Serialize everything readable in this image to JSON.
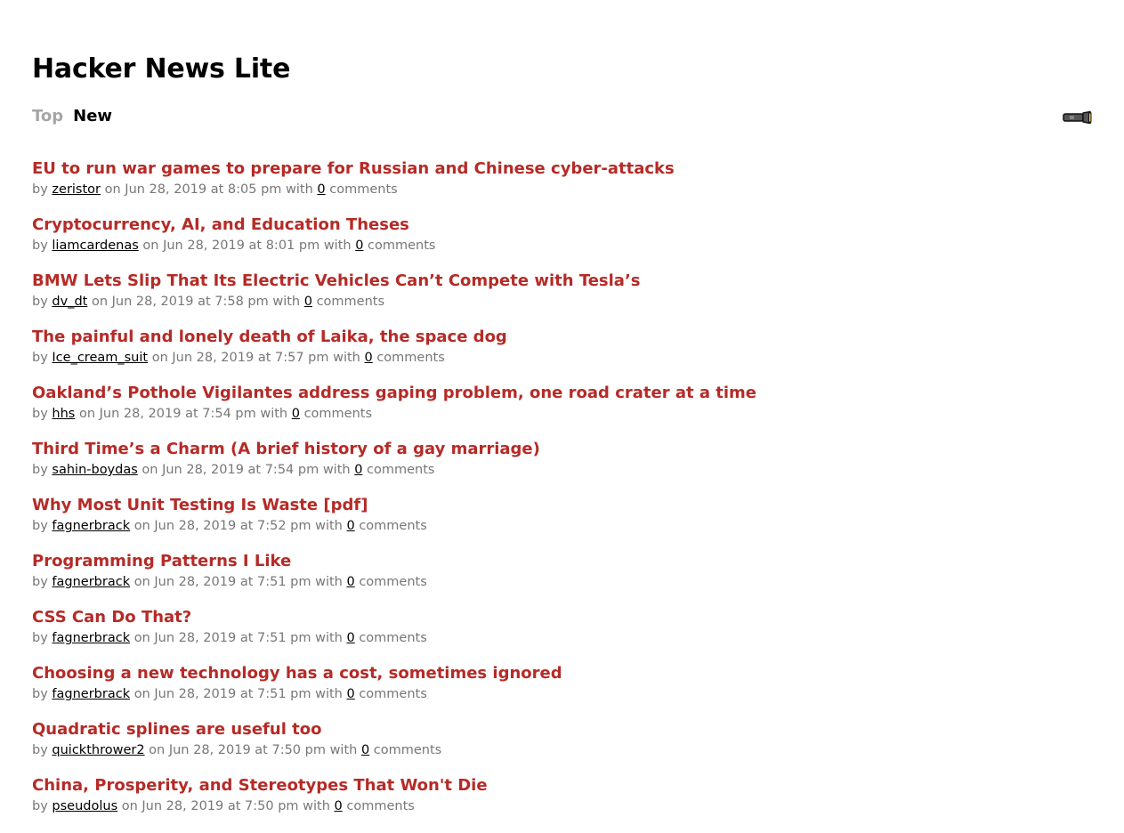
{
  "site": {
    "title": "Hacker News Lite"
  },
  "nav": {
    "tabs": [
      {
        "label": "Top",
        "active": false
      },
      {
        "label": "New",
        "active": true
      }
    ],
    "theme_toggle_icon": "flashlight-icon"
  },
  "meta_words": {
    "by": "by",
    "on": "on",
    "with": "with",
    "comments": "comments"
  },
  "stories": [
    {
      "title": "EU to run war games to prepare for Russian and Chinese cyber-attacks",
      "author": "zeristor",
      "date": "Jun 28, 2019 at 8:05 pm",
      "comments": "0"
    },
    {
      "title": "Cryptocurrency, AI, and Education Theses",
      "author": "liamcardenas",
      "date": "Jun 28, 2019 at 8:01 pm",
      "comments": "0"
    },
    {
      "title": "BMW Lets Slip That Its Electric Vehicles Can’t Compete with Tesla’s",
      "author": "dv_dt",
      "date": "Jun 28, 2019 at 7:58 pm",
      "comments": "0"
    },
    {
      "title": "The painful and lonely death of Laika, the space dog",
      "author": "Ice_cream_suit",
      "date": "Jun 28, 2019 at 7:57 pm",
      "comments": "0"
    },
    {
      "title": "Oakland’s Pothole Vigilantes address gaping problem, one road crater at a time",
      "author": "hhs",
      "date": "Jun 28, 2019 at 7:54 pm",
      "comments": "0"
    },
    {
      "title": "Third Time’s a Charm (A brief history of a gay marriage)",
      "author": "sahin-boydas",
      "date": "Jun 28, 2019 at 7:54 pm",
      "comments": "0"
    },
    {
      "title": "Why Most Unit Testing Is Waste [pdf]",
      "author": "fagnerbrack",
      "date": "Jun 28, 2019 at 7:52 pm",
      "comments": "0"
    },
    {
      "title": "Programming Patterns I Like",
      "author": "fagnerbrack",
      "date": "Jun 28, 2019 at 7:51 pm",
      "comments": "0"
    },
    {
      "title": "CSS Can Do That?",
      "author": "fagnerbrack",
      "date": "Jun 28, 2019 at 7:51 pm",
      "comments": "0"
    },
    {
      "title": "Choosing a new technology has a cost, sometimes ignored",
      "author": "fagnerbrack",
      "date": "Jun 28, 2019 at 7:51 pm",
      "comments": "0"
    },
    {
      "title": "Quadratic splines are useful too",
      "author": "quickthrower2",
      "date": "Jun 28, 2019 at 7:50 pm",
      "comments": "0"
    },
    {
      "title": "China, Prosperity, and Stereotypes That Won't Die",
      "author": "pseudolus",
      "date": "Jun 28, 2019 at 7:50 pm",
      "comments": "0"
    }
  ],
  "colors": {
    "story_title": "#b52b27",
    "meta_text": "#777777",
    "inactive_tab": "#a6a6a6"
  }
}
